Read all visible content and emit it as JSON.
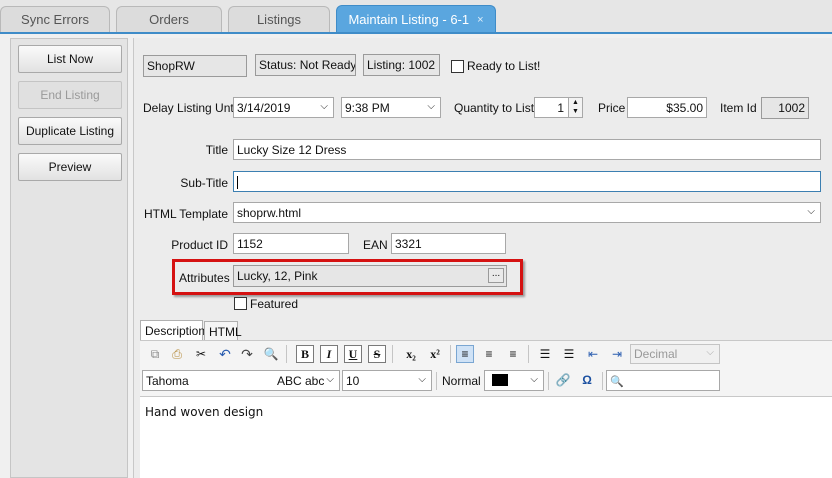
{
  "tabs": [
    {
      "label": "Sync Errors"
    },
    {
      "label": "Orders"
    },
    {
      "label": "Listings"
    },
    {
      "label": "Maintain Listing - 6-1",
      "close": "×"
    }
  ],
  "sidebar": {
    "list_now": "List Now",
    "end_listing": "End Listing",
    "duplicate_listing": "Duplicate Listing",
    "preview": "Preview"
  },
  "header": {
    "store": "ShopRW",
    "status": "Status: Not Ready",
    "listing": "Listing: 1002",
    "ready_label": "Ready to List!"
  },
  "form": {
    "delay_label": "Delay Listing Until",
    "delay_date": "3/14/2019",
    "delay_time": "9:38 PM",
    "qty_label": "Quantity to List",
    "qty_value": "1",
    "price_label": "Price",
    "price_value": "$35.00",
    "item_id_label": "Item Id",
    "item_id_value": "1002",
    "title_label": "Title",
    "title_value": "Lucky Size 12 Dress",
    "subtitle_label": "Sub-Title",
    "subtitle_value": "",
    "template_label": "HTML Template",
    "template_value": "shoprw.html",
    "product_id_label": "Product ID",
    "product_id_value": "1152",
    "ean_label": "EAN",
    "ean_value": "3321",
    "attributes_label": "Attributes",
    "attributes_value": "Lucky, 12, Pink",
    "attributes_button": "...",
    "featured_label": "Featured"
  },
  "editor": {
    "tab_description": "Description",
    "tab_html": "HTML",
    "font_name": "Tahoma",
    "font_preview": "ABC abc",
    "font_size": "10",
    "style_label": "Normal",
    "format_select": "Decimal",
    "content": "Hand woven design"
  },
  "colors": {
    "active_tab": "#5aa6df",
    "highlight_box": "#d51212",
    "focus_border": "#3c7fb1"
  }
}
